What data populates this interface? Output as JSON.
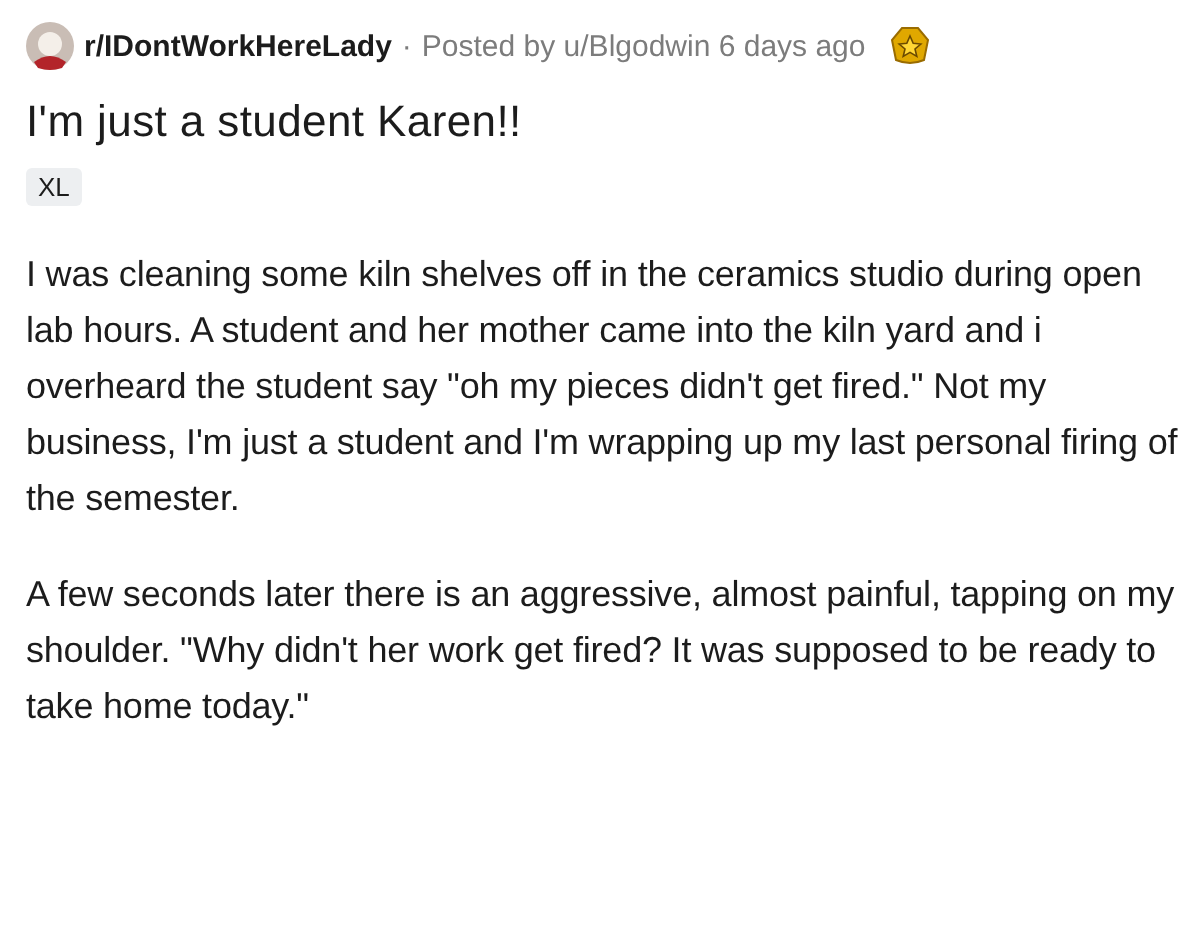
{
  "post": {
    "subreddit": "r/IDontWorkHereLady",
    "separator": "·",
    "byline": "Posted by u/Blgodwin 6 days ago",
    "title": "I'm just a student Karen!!",
    "flair": "XL",
    "paragraphs": [
      "I was cleaning some kiln shelves off in the ceramics studio during open lab hours. A student and her mother came into the kiln yard and i overheard the student say \"oh my pieces didn't get fired.\" Not my business, I'm just a student and I'm wrapping up my last personal firing of the semester.",
      "A few seconds later there is an aggressive, almost painful, tapping on my shoulder. \"Why didn't her work get fired? It was supposed to be ready to take home today.\""
    ]
  }
}
